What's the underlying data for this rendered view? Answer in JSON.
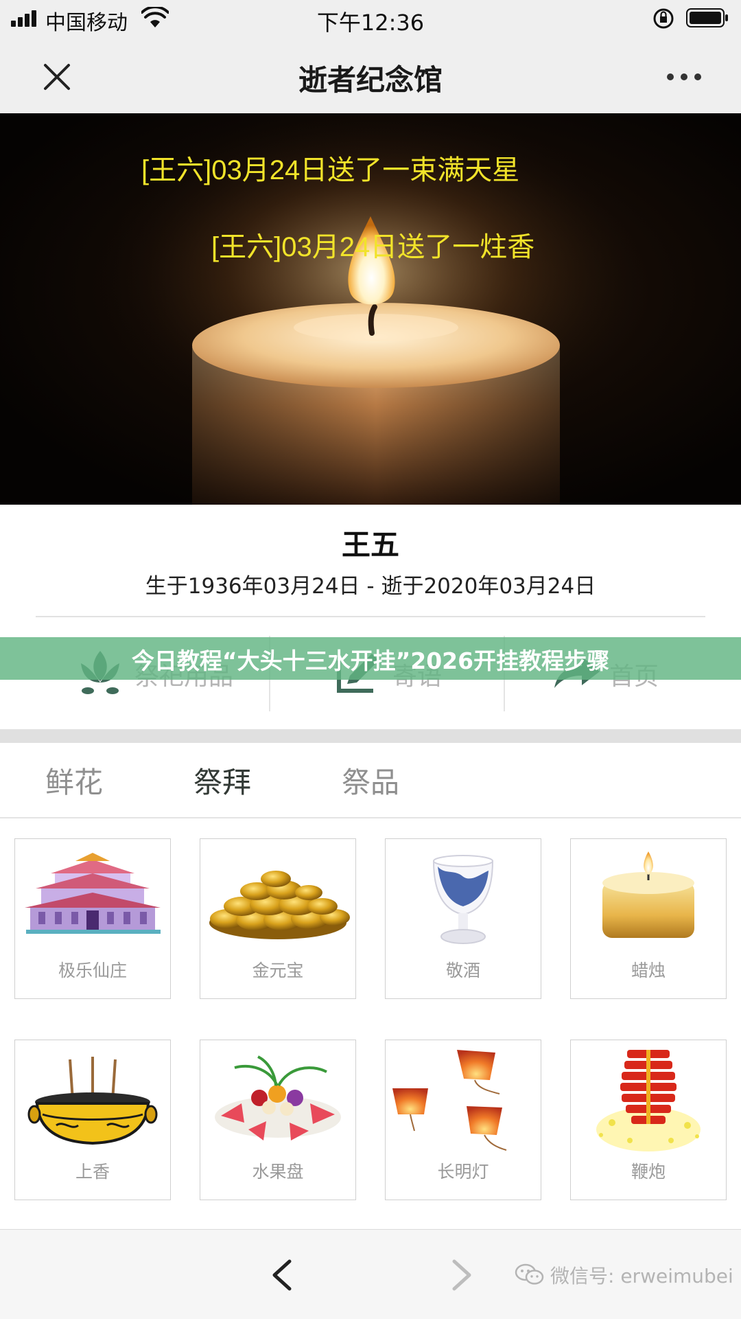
{
  "status_bar": {
    "carrier": "中国移动",
    "time": "下午12:36"
  },
  "nav": {
    "title": "逝者纪念馆"
  },
  "hero": {
    "messages": [
      "[王六]03月24日送了一束满天星",
      "[王六]03月24日送了一炷香"
    ]
  },
  "profile": {
    "name": "王五",
    "dates": "生于1936年03月24日 - 逝于2020年03月24日"
  },
  "actions": [
    {
      "label": "祭祀用品",
      "icon": "lotus-icon"
    },
    {
      "label": "寄语",
      "icon": "edit-icon"
    },
    {
      "label": "首页",
      "icon": "share-arrow-icon"
    }
  ],
  "banner": {
    "text": "今日教程“大头十三水开挂”2026开挂教程步骤"
  },
  "tabs": [
    {
      "label": "鲜花",
      "active": false
    },
    {
      "label": "祭拜",
      "active": true
    },
    {
      "label": "祭品",
      "active": false
    }
  ],
  "products": [
    {
      "label": "极乐仙庄",
      "icon": "palace-icon"
    },
    {
      "label": "金元宝",
      "icon": "gold-ingots-icon"
    },
    {
      "label": "敬酒",
      "icon": "wine-cup-icon"
    },
    {
      "label": "蜡烛",
      "icon": "candle-icon"
    },
    {
      "label": "上香",
      "icon": "incense-burner-icon"
    },
    {
      "label": "水果盘",
      "icon": "fruit-platter-icon"
    },
    {
      "label": "长明灯",
      "icon": "sky-lantern-icon"
    },
    {
      "label": "鞭炮",
      "icon": "firecracker-icon"
    }
  ],
  "bottom_bar": {
    "watermark": "微信号: erweimubei"
  },
  "colors": {
    "hero_text": "#f1e32a",
    "banner_bg": "#62b482",
    "icon_green": "#3f6b5a"
  }
}
